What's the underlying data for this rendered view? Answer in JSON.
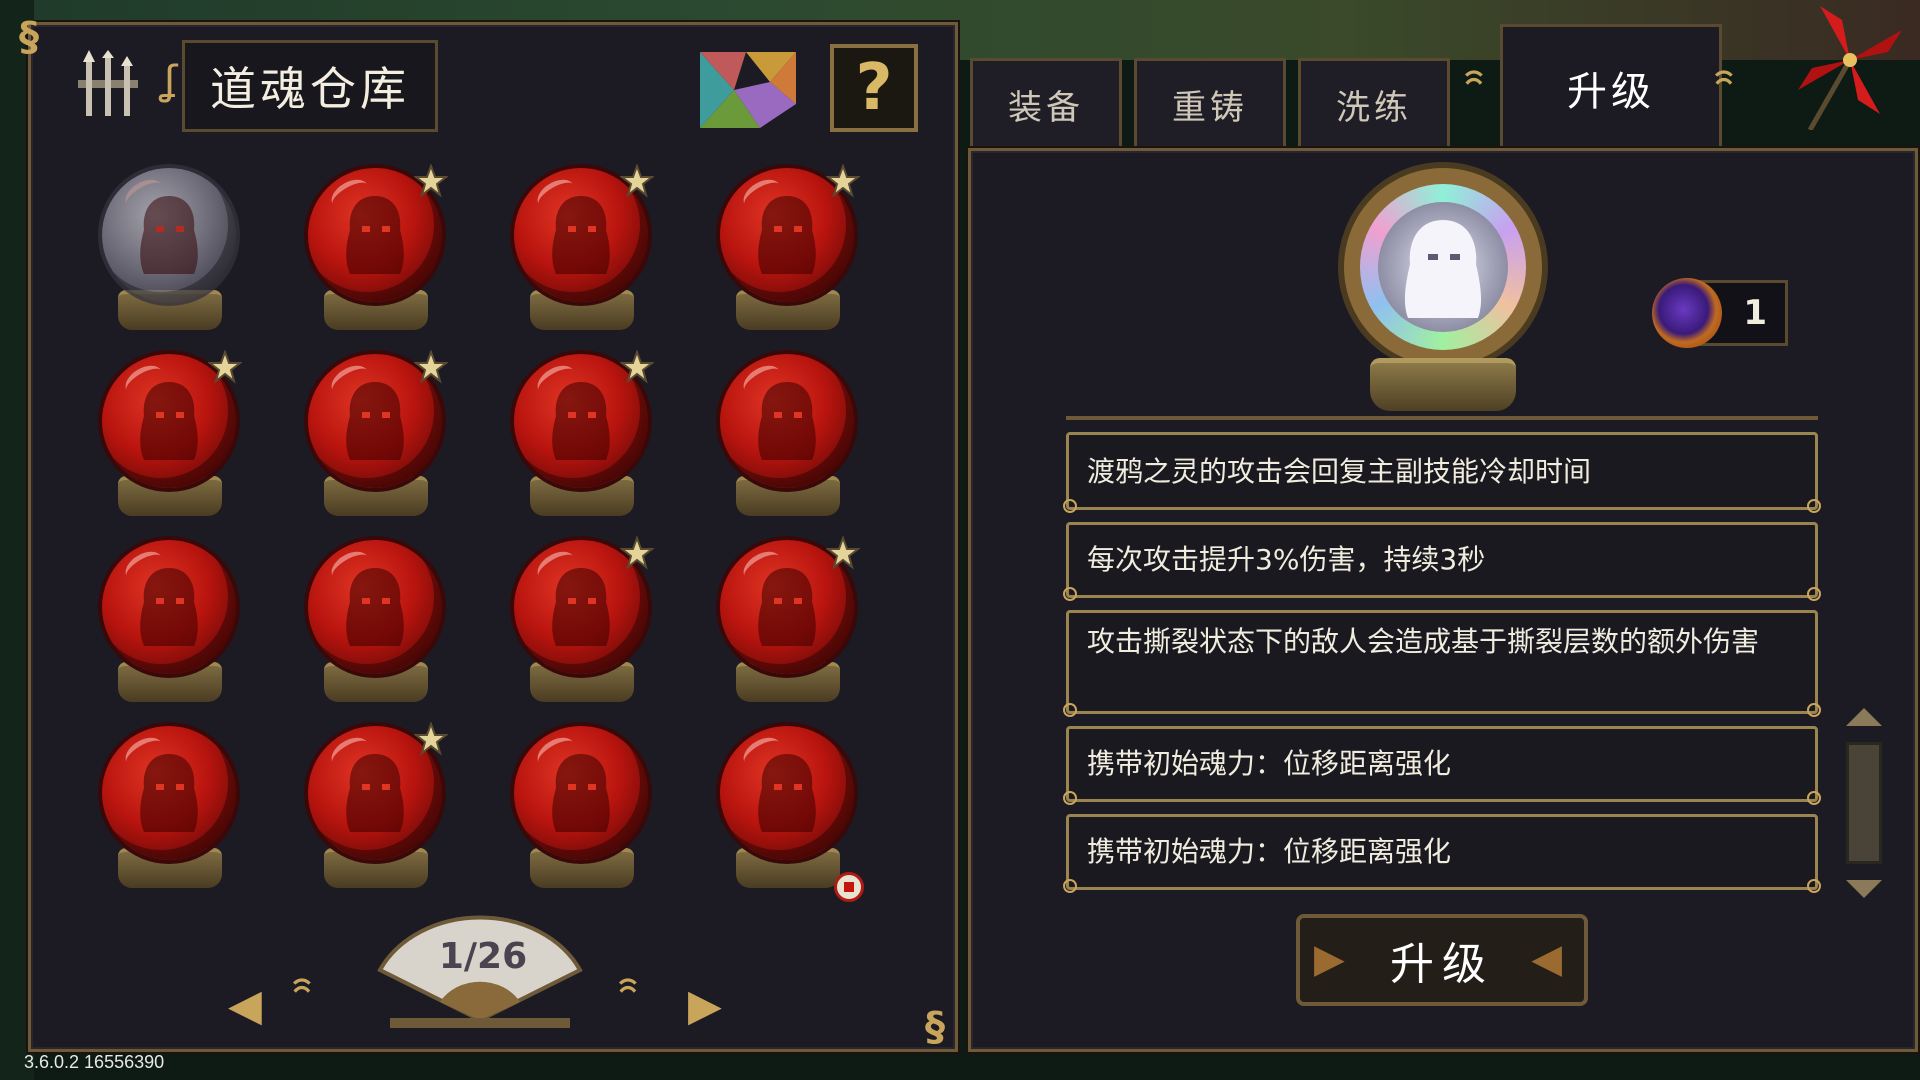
{
  "left_panel": {
    "title": "道魂仓库",
    "help_label": "?",
    "pager": {
      "text": "1/26"
    },
    "orbs": [
      {
        "style": "gray",
        "star": false
      },
      {
        "style": "red",
        "star": true
      },
      {
        "style": "red",
        "star": true
      },
      {
        "style": "red",
        "star": true
      },
      {
        "style": "red",
        "star": true
      },
      {
        "style": "red",
        "star": true
      },
      {
        "style": "red",
        "star": true
      },
      {
        "style": "red",
        "star": false
      },
      {
        "style": "red",
        "star": false
      },
      {
        "style": "red",
        "star": false
      },
      {
        "style": "red",
        "star": true
      },
      {
        "style": "red",
        "star": true
      },
      {
        "style": "red",
        "star": false
      },
      {
        "style": "red",
        "star": true
      },
      {
        "style": "red",
        "star": false
      },
      {
        "style": "red",
        "star": false
      }
    ]
  },
  "tabs": [
    {
      "label": "装备",
      "active": false
    },
    {
      "label": "重铸",
      "active": false
    },
    {
      "label": "洗练",
      "active": false
    },
    {
      "label": "升级",
      "active": true
    }
  ],
  "right_panel": {
    "currency_count": "1",
    "descriptions": [
      "渡鸦之灵的攻击会回复主副技能冷却时间",
      "每次攻击提升3%伤害，持续3秒",
      "攻击撕裂状态下的敌人会造成基于撕裂层数的额外伤害",
      "携带初始魂力：位移距离强化",
      "携带初始魂力：位移距离强化"
    ],
    "upgrade_button": "升级"
  },
  "version": "3.6.0.2 16556390",
  "colors": {
    "panel_bg": "#1c1b24",
    "gold_border": "#6e5a38",
    "orb_red": "#b8140e",
    "accent_gold": "#c9a55c"
  }
}
